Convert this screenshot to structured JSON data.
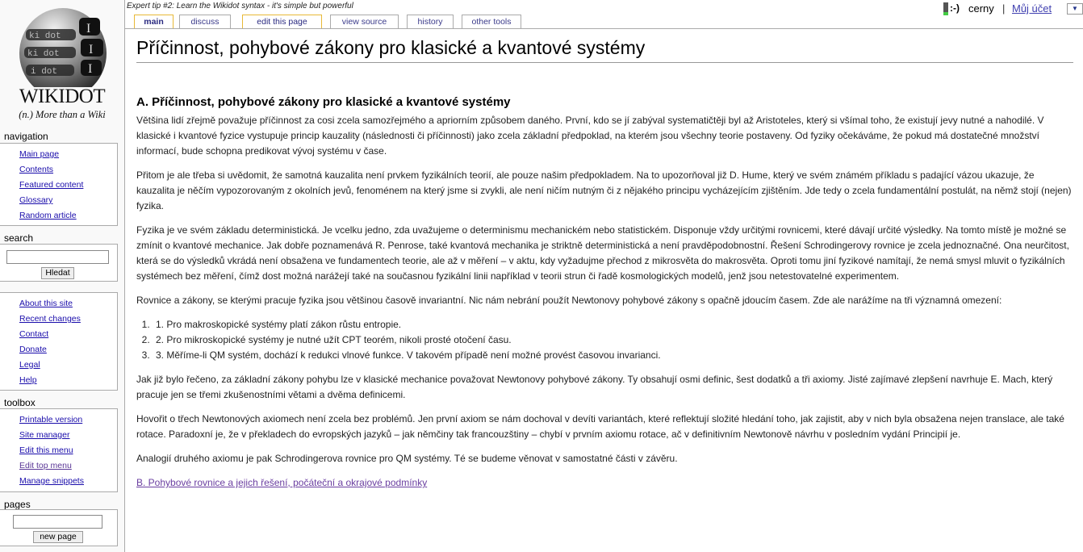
{
  "logo": {
    "wordmark": "WIKIDOT",
    "tagline": "(n.) More than a Wiki"
  },
  "header": {
    "tip": "Expert tip #2: Learn the Wikidot syntax - it's simple but powerful",
    "tabs": [
      {
        "label": "main",
        "state": "active"
      },
      {
        "label": "discuss",
        "state": "normal"
      },
      {
        "label": "edit this page",
        "state": "highlight"
      },
      {
        "label": "view source",
        "state": "normal"
      },
      {
        "label": "history",
        "state": "normal"
      },
      {
        "label": "other tools",
        "state": "normal"
      }
    ]
  },
  "userbar": {
    "smiley": ":-)",
    "username": "cerny",
    "separator": "|",
    "account_link": "Můj účet",
    "dropdown_icon": "▼"
  },
  "sidebar": {
    "navigation": {
      "title": "navigation",
      "items": [
        "Main page",
        "Contents",
        "Featured content",
        "Glossary",
        "Random article"
      ]
    },
    "search": {
      "title": "search",
      "input_value": "",
      "button": "Hledat"
    },
    "info": {
      "items": [
        "About this site",
        "Recent changes",
        "Contact",
        "Donate",
        "Legal",
        "Help"
      ]
    },
    "toolbox": {
      "title": "toolbox",
      "items": [
        "Printable version",
        "Site manager",
        "Edit this menu",
        "Edit top menu",
        "Manage snippets"
      ]
    },
    "pages": {
      "title": "pages",
      "input_value": "",
      "button": "new page"
    }
  },
  "page": {
    "title": "Příčinnost, pohybové zákony pro klasické a kvantové systémy",
    "section_heading": "A. Příčinnost, pohybové zákony pro klasické a kvantové systémy",
    "paragraphs": [
      "Většina lidí zřejmě považuje příčinnost za cosi zcela samozřejmého a apriorním způsobem daného. První, kdo se jí zabýval systematičtěji byl až Aristoteles, který si všímal toho, že existují jevy nutné a nahodilé. V klasické i kvantové fyzice vystupuje princip kauzality (následnosti či příčinnosti) jako zcela základní předpoklad, na kterém jsou všechny teorie postaveny. Od fyziky očekáváme, že pokud má dostatečné množství informací, bude schopna predikovat vývoj systému v čase.",
      "Přitom je ale třeba si uvědomit, že samotná kauzalita není prvkem fyzikálních teorií, ale pouze našim předpokladem. Na to upozorňoval již D. Hume, který ve svém známém příkladu s padající vázou ukazuje, že kauzalita je něčím vypozorovaným z okolních jevů, fenoménem na který jsme si zvykli, ale není ničím nutným či z nějakého principu vycházejícím zjištěním. Jde tedy o zcela fundamentální postulát, na němž stojí (nejen) fyzika.",
      "Fyzika je ve svém základu deterministická. Je vcelku jedno, zda uvažujeme o determinismu mechanickém nebo statistickém. Disponuje vždy určitými rovnicemi, které dávají určité výsledky. Na tomto místě je možné se zmínit o kvantové mechanice. Jak dobře poznamenává R. Penrose, také kvantová mechanika je striktně deterministická a není pravděpodobnostní. Řešení Schrodingerovy rovnice je zcela jednoznačné. Ona neurčitost, která se do výsledků vkrádá není obsažena ve fundamentech teorie, ale až v měření – v aktu, kdy vyžadujme přechod z mikrosvěta do makrosvěta. Oproti tomu jiní fyzikové namítají, že nemá smysl mluvit o fyzikálních systémech bez měření, čímž dost možná narážejí také na současnou fyzikální linii například v teorii strun či řadě kosmologických modelů, jenž jsou netestovatelné experimentem.",
      "Rovnice a zákony, se kterými pracuje fyzika jsou většinou časově invariantní. Nic nám nebrání použít Newtonovy pohybové zákony s opačně jdoucím časem. Zde ale narážíme na tři významná omezení:"
    ],
    "list": [
      "1. Pro makroskopické systémy platí zákon růstu entropie.",
      "2. Pro mikroskopické systémy je nutné užít CPT teorém, nikoli prosté otočení času.",
      "3. Měříme-li QM systém, dochází k redukci vlnové funkce. V takovém případě není možné provést časovou invarianci."
    ],
    "paragraphs_after": [
      "Jak již bylo řečeno, za základní zákony pohybu lze v klasické mechanice považovat Newtonovy pohybové zákony. Ty obsahují osmi definic, šest dodatků a tři axiomy. Jisté zajímavé zlepšení navrhuje E. Mach, který pracuje jen se třemi zkušenostními větami a dvěma definicemi.",
      "Hovořit o třech Newtonových axiomech není zcela bez problémů. Jen první axiom se nám dochoval v devíti variantách, které reflektují složité hledání toho, jak zajistit, aby v nich byla obsažena nejen translace, ale také rotace. Paradoxní je, že v překladech do evropských jazyků – jak němčiny tak francouzštiny – chybí v prvním axiomu rotace, ač v definitivním Newtonově návrhu v posledním vydání Principií je.",
      "Analogií druhého axiomu je pak Schrodingerova rovnice pro QM systémy. Té se budeme věnovat v samostatné části v závěru."
    ],
    "next_link": "B. Pohybové rovnice a jejich řešení, počáteční a okrajové podmínky"
  }
}
